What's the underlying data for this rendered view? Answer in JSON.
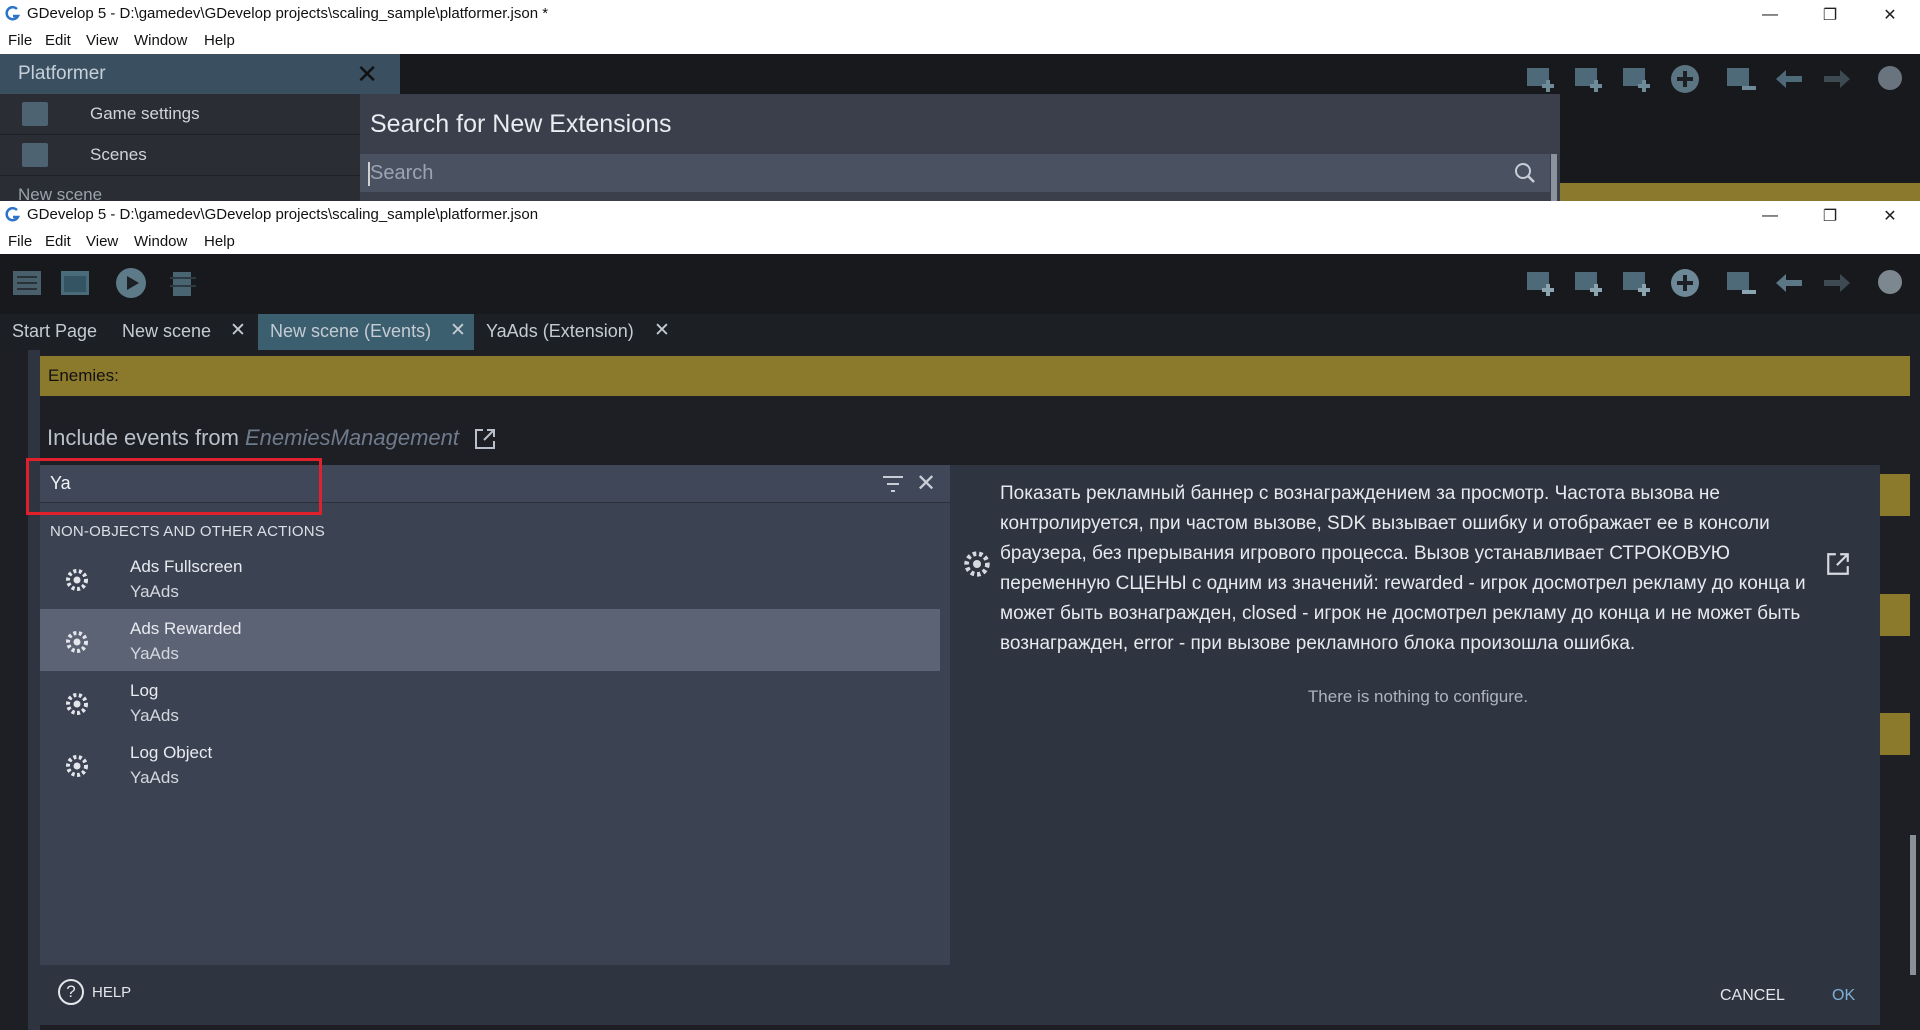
{
  "upper_window": {
    "title": "GDevelop 5 - D:\\gamedev\\GDevelop projects\\scaling_sample\\platformer.json *",
    "menu": [
      "File",
      "Edit",
      "View",
      "Window",
      "Help"
    ],
    "controls": {
      "minimize": "—",
      "maximize": "❐",
      "close": "✕"
    },
    "project_manager": {
      "title": "Platformer",
      "close": "✕",
      "items": [
        {
          "label": "Game settings",
          "icon": "game-settings-icon"
        },
        {
          "label": "Scenes",
          "icon": "scenes-icon"
        }
      ],
      "partial_item": "New scene"
    },
    "extension_search": {
      "heading": "Search for New Extensions",
      "placeholder": "Search"
    }
  },
  "lower_window": {
    "title": "GDevelop 5 - D:\\gamedev\\GDevelop projects\\scaling_sample\\platformer.json",
    "menu": [
      "File",
      "Edit",
      "View",
      "Window",
      "Help"
    ],
    "controls": {
      "minimize": "—",
      "maximize": "❐",
      "close": "✕"
    },
    "tabs": [
      {
        "label": "Start Page",
        "closable": false
      },
      {
        "label": "New scene",
        "closable": true
      },
      {
        "label": "New scene (Events)",
        "closable": true,
        "active": true
      },
      {
        "label": "YaAds (Extension)",
        "closable": true
      }
    ],
    "tab_close": "✕",
    "comment_event": "Enemies:",
    "include_events": {
      "prefix": "Include events from",
      "external": "EnemiesManagement"
    }
  },
  "action_dialog": {
    "search_value": "Ya",
    "close": "✕",
    "section_header": "NON-OBJECTS AND OTHER ACTIONS",
    "items": [
      {
        "name": "Ads Fullscreen",
        "source": "YaAds",
        "selected": false
      },
      {
        "name": "Ads Rewarded",
        "source": "YaAds",
        "selected": true
      },
      {
        "name": "Log",
        "source": "YaAds",
        "selected": false
      },
      {
        "name": "Log Object",
        "source": "YaAds",
        "selected": false
      }
    ],
    "description": "Показать рекламный баннер с вознаграждением за просмотр. Частота вызова не контролируется, при частом вызове, SDK вызывает ошибку и отображает ее в консоли браузера, без прерывания игрового процесса. Вызов устанавливает СТРОКОВУЮ переменную СЦЕНЫ с одним из значений: rewarded - игрок досмотрел рекламу до конца и может быть вознагражден, closed - игрок не досмотрел рекламу до конца и не может быть вознагражден, error - при вызове рекламного блока произошла ошибка.",
    "nothing_to_configure": "There is nothing to configure.",
    "help_label": "HELP",
    "help_icon": "?",
    "cancel_label": "CANCEL",
    "ok_label": "OK"
  },
  "colors": {
    "accent_tab": "#3c5f70",
    "comment_gold": "#8c7a2c",
    "highlight_red": "#e0202a",
    "ok_blue": "#7fb0d6"
  }
}
